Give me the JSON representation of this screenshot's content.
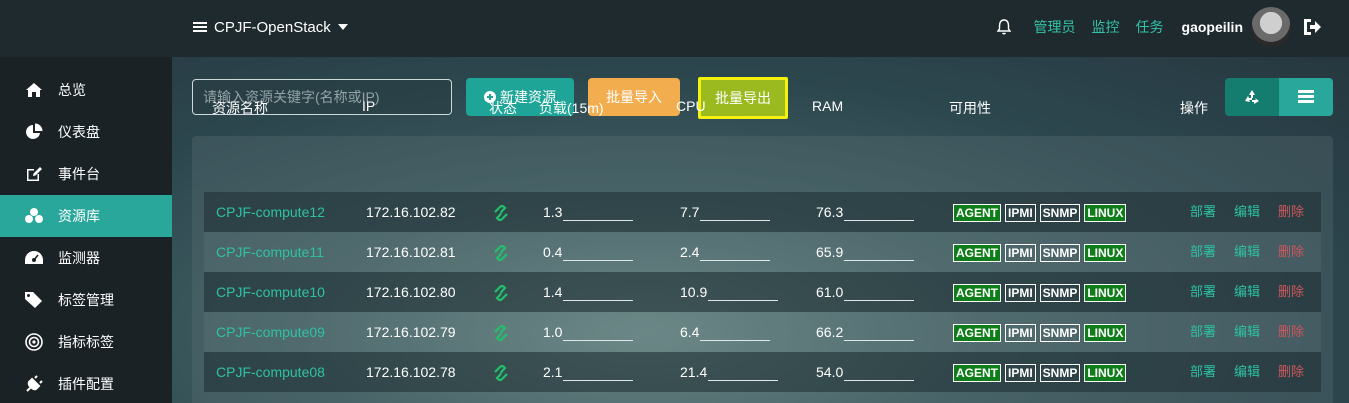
{
  "header": {
    "project": "CPJF-OpenStack",
    "links": [
      "管理员",
      "监控",
      "任务"
    ],
    "username": "gaopeilin"
  },
  "sidebar": {
    "items": [
      {
        "label": "总览",
        "icon": "home-icon"
      },
      {
        "label": "仪表盘",
        "icon": "pie-chart-icon"
      },
      {
        "label": "事件台",
        "icon": "edit-icon"
      },
      {
        "label": "资源库",
        "icon": "cubes-icon",
        "active": true
      },
      {
        "label": "监测器",
        "icon": "dashboard-icon"
      },
      {
        "label": "标签管理",
        "icon": "tags-icon"
      },
      {
        "label": "指标标签",
        "icon": "target-icon"
      },
      {
        "label": "插件配置",
        "icon": "plug-icon"
      }
    ]
  },
  "toolbar": {
    "search_placeholder": "请输入资源关键字(名称或IP)",
    "new_label": "新建资源",
    "import_label": "批量导入",
    "export_label": "批量导出"
  },
  "table": {
    "headers": [
      "资源名称",
      "IP",
      "状态",
      "负载(15m)",
      "CPU",
      "RAM",
      "可用性",
      "操作"
    ],
    "rows": [
      {
        "name": "CPJF-compute12",
        "ip": "172.16.102.82",
        "load": "1.3",
        "cpu": "7.7",
        "ram": "76.3"
      },
      {
        "name": "CPJF-compute11",
        "ip": "172.16.102.81",
        "load": "0.4",
        "cpu": "2.4",
        "ram": "65.9"
      },
      {
        "name": "CPJF-compute10",
        "ip": "172.16.102.80",
        "load": "1.4",
        "cpu": "10.9",
        "ram": "61.0"
      },
      {
        "name": "CPJF-compute09",
        "ip": "172.16.102.79",
        "load": "1.0",
        "cpu": "6.4",
        "ram": "66.2"
      },
      {
        "name": "CPJF-compute08",
        "ip": "172.16.102.78",
        "load": "2.1",
        "cpu": "21.4",
        "ram": "54.0"
      }
    ],
    "badges": [
      "AGENT",
      "IPMI",
      "SNMP",
      "LINUX"
    ],
    "ops": [
      "部署",
      "编辑",
      "删除"
    ]
  },
  "colors": {
    "accent": "#2aa79b",
    "import": "#f1ad4e",
    "export": "#9bba1f",
    "highlight": "#f4f10f",
    "ok_badge": "#0f7d1a",
    "delete": "#d0575c"
  }
}
